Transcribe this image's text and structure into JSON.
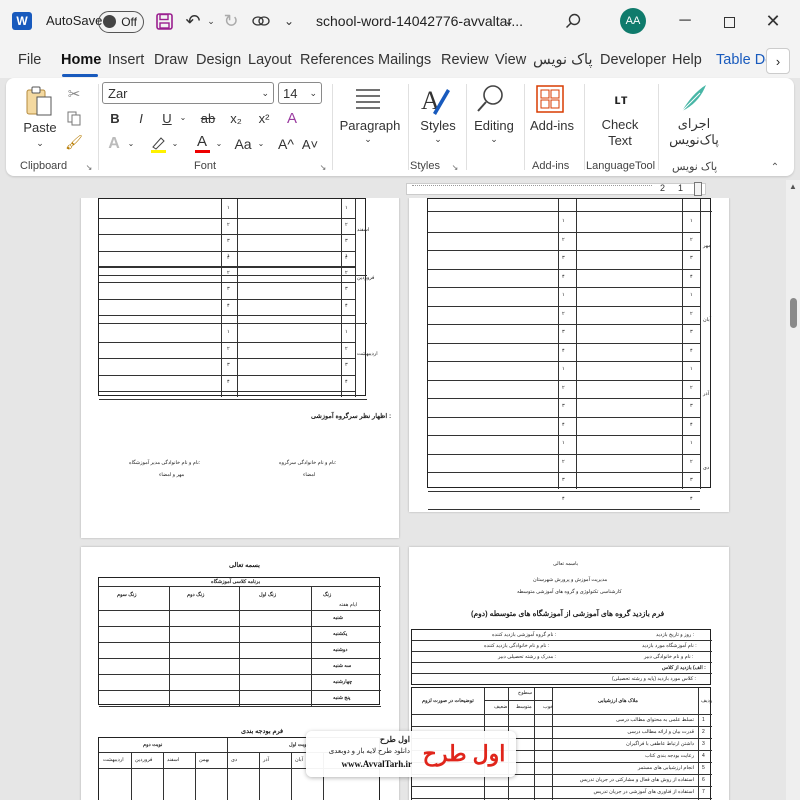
{
  "titlebar": {
    "autosave_label": "AutoSave",
    "autosave_state": "Off",
    "document_title": "school-word-14042776-avvaltar...",
    "user_initials": "AA"
  },
  "tabs": [
    "File",
    "Home",
    "Insert",
    "Draw",
    "Design",
    "Layout",
    "References",
    "Mailings",
    "Review",
    "View",
    "پاک نویس",
    "Developer",
    "Help",
    "Table De"
  ],
  "active_tab": "Home",
  "ribbon": {
    "clipboard": {
      "paste": "Paste",
      "label": "Clipboard"
    },
    "font": {
      "name": "Zar",
      "size": "14",
      "label": "Font",
      "bold": "B",
      "italic": "I",
      "underline": "U",
      "strike": "ab",
      "sub": "x₂",
      "sup": "x²",
      "case": "Aa",
      "grow": "A^",
      "shrink": "A˅"
    },
    "paragraph": {
      "label": "Paragraph"
    },
    "styles": {
      "button": "Styles",
      "label": "Styles"
    },
    "editing": {
      "button": "Editing"
    },
    "addins": {
      "button": "Add-ins",
      "label": "Add-ins"
    },
    "checktext": {
      "line1": "Check",
      "line2": "Text",
      "label": "LanguageTool"
    },
    "paknevis": {
      "line1": "اجرای",
      "line2": "پاک‌نویس",
      "label": "پاک نویس"
    }
  },
  "ruler": {
    "marks": [
      "2",
      "1",
      "2"
    ]
  },
  "pages": {
    "p1": {
      "row_groups": [
        "اسفند",
        "فروردین",
        "اردیبهشت"
      ],
      "nums": [
        "۱",
        "۲",
        "۳",
        "۴"
      ],
      "opinion": "اظهار نظر سرگروه آموزشی :",
      "sig_left_1": "نام و نام خانوادگی مدیر آموزشگاه:",
      "sig_left_2": "مهر و امضاء",
      "sig_right_1": "نام و نام خانوادگی سرگروه:",
      "sig_right_2": "امضاء"
    },
    "p2": {
      "row_groups": [
        "مهر",
        "آبان",
        "آذر",
        "دی"
      ],
      "nums": [
        "۱",
        "۲",
        "۳",
        "۴"
      ]
    },
    "p3": {
      "bismillah": "بسمه تعالی",
      "table_title": "برنامه کلاسی آموزشگاه",
      "headers": [
        "زنگ سوم",
        "زنگ دوم",
        "زنگ اول",
        "زنگ"
      ],
      "corner_sub": "ایام هفته",
      "days": [
        "شنبه",
        "یکشنبه",
        "دوشنبه",
        "سه شنبه",
        "چهارشنبه",
        "پنج شنبه"
      ],
      "budget_title": "فرم بودجه بندی",
      "budget_headers": [
        "نوبت دوم",
        "نوبت اول"
      ],
      "months": [
        "اردیبهشت",
        "فروردین",
        "اسفند",
        "بهمن",
        "دی",
        "آذر",
        "آبان"
      ]
    },
    "p4": {
      "bismillah": "باسمه تعالی",
      "org_1": "مدیریت آموزش و پرورش شهرستان",
      "org_2": "کارشناسی تکنولوژی و گروه های آموزشی متوسطه",
      "form_title": "فرم بازدید گروه های آموزشی از آموزشگاه های متوسطه (دوم)",
      "field_1": "روز و تاریخ بازدید :",
      "field_2": "نام گروه آموزشی بازدید کننده :",
      "field_3": "نام آموزشگاه مورد بازدید :",
      "field_4": "نام و نام خانوادگی بازدید کننده :",
      "field_5": "نام و نام خانوادگی دبیر :",
      "field_6": "مدرک و رشته تحصیلی دبیر :",
      "field_7": "الف) بازدید از کلاس :",
      "field_8": "کلاس مورد بازدید (پایه و رشته تحصیلی) :",
      "col_row": "ردیف",
      "col_criteria": "ملاک های ارزشیابی",
      "col_levels": "سطوح",
      "col_good": "خوب",
      "col_mid": "متوسط",
      "col_weak": "ضعیف",
      "col_notes": "توضیحات در صورت لزوم",
      "criteria": [
        "تسلط علمی به محتوای مطالب درسی",
        "قدرت بیان و ارائه مطالب درسی",
        "داشتن ارتباط عاطفی با فراگیران",
        "رعایت بودجه بندی کتاب",
        "انجام ارزشیابی های مستمر",
        "استفاده از روش های فعال و مشارکتی در جریان تدریس",
        "استفاده از فناوری های آموزشی در جریان تدریس"
      ]
    }
  },
  "watermark": {
    "line1": "اول طرح",
    "line2": "دانلود طرح لایه باز و دوبعدی",
    "url": "www.AvvalTarh.ir",
    "logo_text": "اول طرح"
  },
  "colors": {
    "accent": "#185abd",
    "avatar": "#0f7b6c",
    "logo_red": "#e0251b",
    "chrome": "#f3f3f3"
  }
}
